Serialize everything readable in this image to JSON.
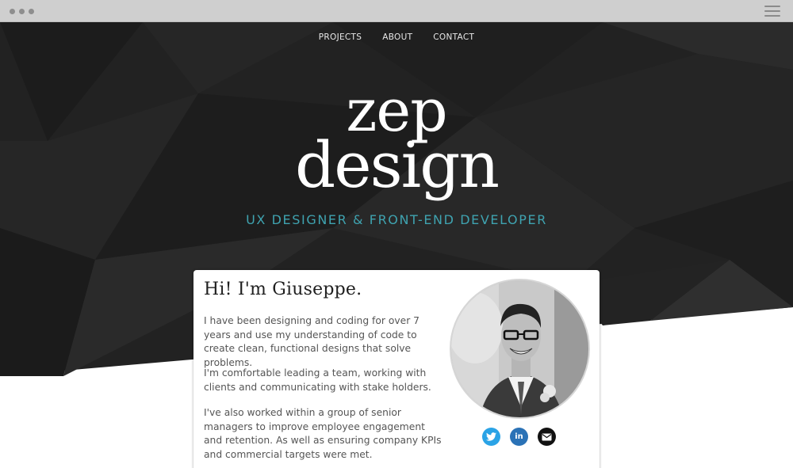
{
  "nav": {
    "items": [
      {
        "label": "PROJECTS"
      },
      {
        "label": "ABOUT"
      },
      {
        "label": "CONTACT"
      }
    ]
  },
  "hero": {
    "logo_line1": "zep",
    "logo_line2": "design",
    "tagline": "UX DESIGNER & FRONT-END DEVELOPER"
  },
  "about": {
    "title": "Hi! I'm Giuseppe.",
    "paragraphs": [
      "I have been designing and coding for over 7 years and use my understanding of code to create clean, functional designs that solve problems.",
      "I'm comfortable leading a team, working with clients and communicating with stake holders.",
      "I've also worked within a group of senior managers to improve employee engagement and retention. As well as ensuring company KPIs and commercial targets were met."
    ]
  },
  "social": [
    {
      "icon": "twitter-icon",
      "color": "#2aa3e6"
    },
    {
      "icon": "linkedin-icon",
      "label": "in",
      "color": "#2a72b6"
    },
    {
      "icon": "email-icon",
      "color": "#111111"
    }
  ],
  "colors": {
    "hero_background": "#202020",
    "accent": "#3fa3b0",
    "chrome": "#cfcfcf"
  }
}
